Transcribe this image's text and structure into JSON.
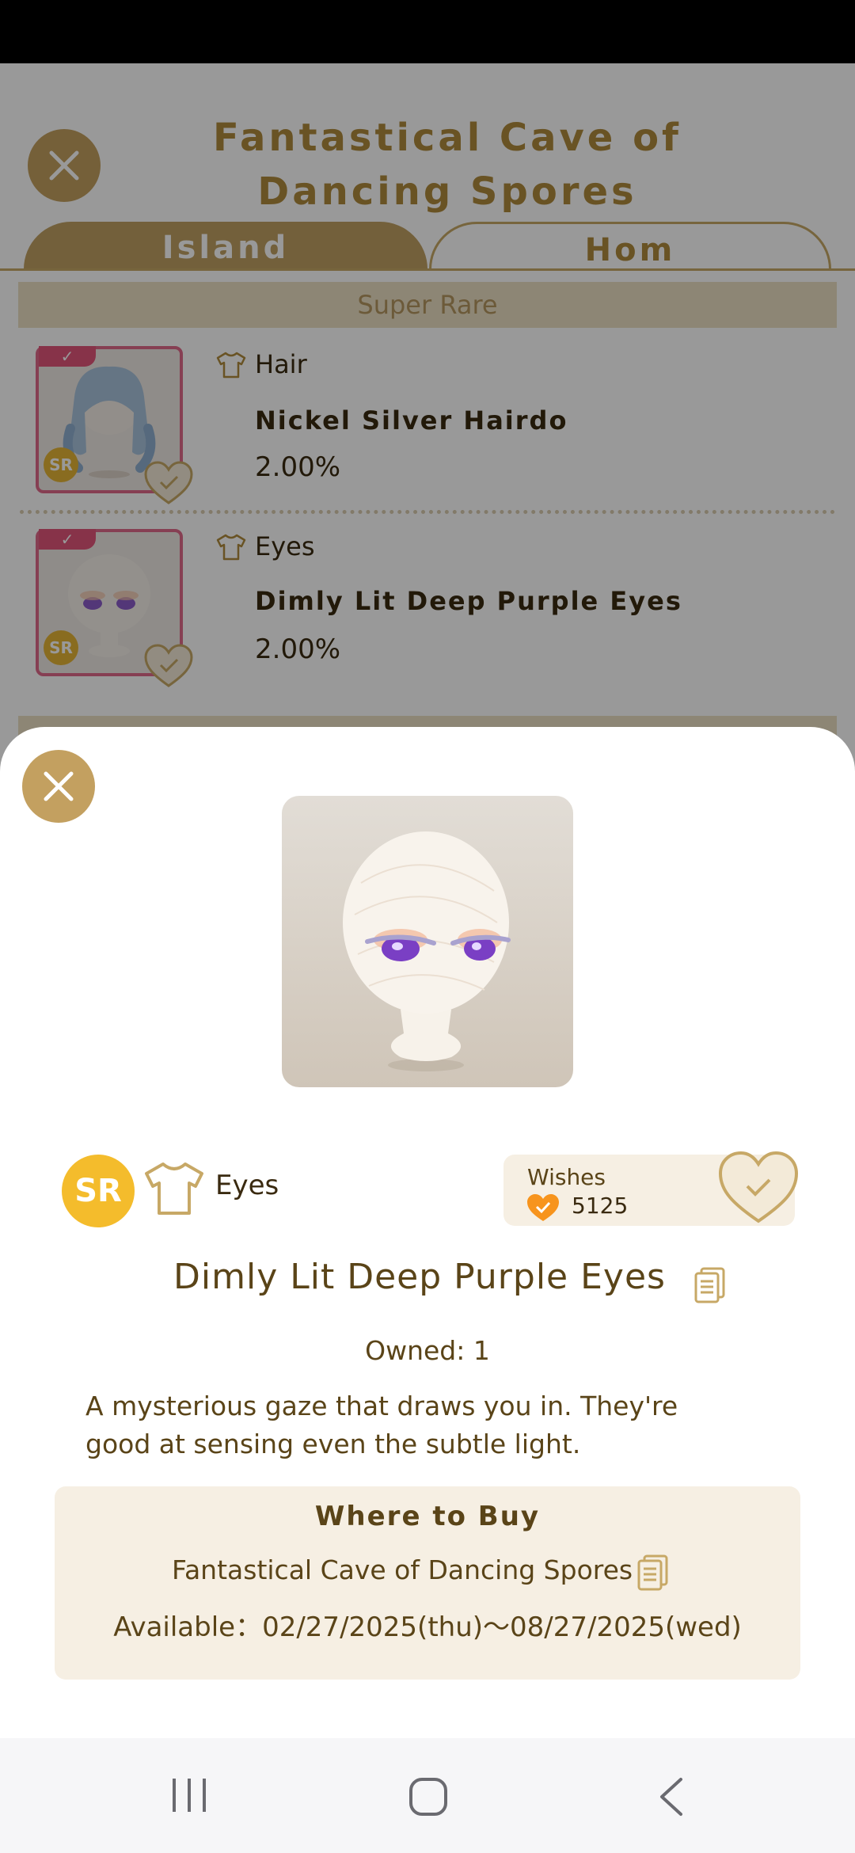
{
  "header": {
    "title": "Fantastical Cave of Dancing Spores"
  },
  "tabs": [
    {
      "label": "Island"
    },
    {
      "label": "Hom"
    }
  ],
  "rarity_section": {
    "label": "Super Rare"
  },
  "items": [
    {
      "category": "Hair",
      "name": "Nickel Silver Hairdo",
      "rate": "2.00%",
      "rarity": "SR",
      "check": "✓"
    },
    {
      "category": "Eyes",
      "name": "Dimly Lit Deep Purple Eyes",
      "rate": "2.00%",
      "rarity": "SR",
      "check": "✓"
    }
  ],
  "detail": {
    "rarity": "SR",
    "category": "Eyes",
    "wishes_label": "Wishes",
    "wishes_count": "5125",
    "name": "Dimly Lit Deep Purple Eyes",
    "owned": "Owned: 1",
    "description": "A mysterious gaze that draws you in. They're good at sensing even the subtle light."
  },
  "where_to_buy": {
    "title": "Where to Buy",
    "place": "Fantastical Cave of Dancing Spores",
    "available": "Available：02/27/2025(thu)～08/27/2025(wed)"
  },
  "colors": {
    "accent_gold": "#c3a060",
    "brand_text": "#5a4418",
    "sr_yellow": "#f4bc2c",
    "selected_pink": "#e06a8a"
  }
}
